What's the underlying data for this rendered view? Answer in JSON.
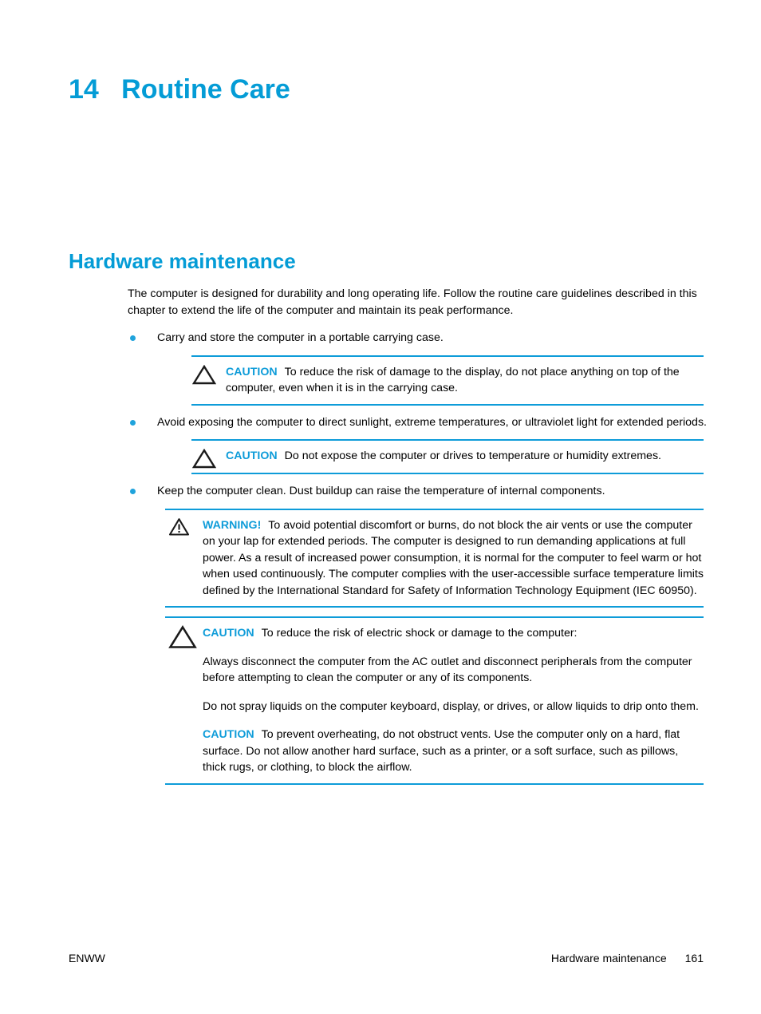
{
  "document": {
    "chapter_number": "14",
    "chapter_title": "Routine Care",
    "section_heading": "Hardware maintenance",
    "accent_color": "#049CD6",
    "rule_color": "#0E9CD9",
    "bullet_color": "#1FA3DC"
  },
  "intro": {
    "paragraph": "The computer is designed for durability and long operating life. Follow the routine care guidelines described in this chapter to extend the life of the computer and maintain its peak performance."
  },
  "bullets": [
    {
      "text": "Carry and store the computer in a portable carrying case."
    },
    {
      "text": "Avoid exposing the computer to direct sunlight, extreme temperatures, or ultraviolet light for extended periods."
    },
    {
      "text": "Keep the computer clean. Dust buildup can raise the temperature of internal components."
    }
  ],
  "admonitions": {
    "caution1": {
      "label": "CAUTION",
      "icon": "caution-triangle-icon",
      "text": "To reduce the risk of damage to the display, do not place anything on top of the computer, even when it is in the carrying case."
    },
    "caution2": {
      "label": "CAUTION",
      "icon": "caution-triangle-icon",
      "text": "Do not expose the computer or drives to temperature or humidity extremes."
    },
    "warning1": {
      "label": "WARNING!",
      "icon": "warning-triangle-exclamation-icon",
      "text": "To avoid potential discomfort or burns, do not block the air vents or use the computer on your lap for extended periods. The computer is designed to run demanding applications at full power. As a result of increased power consumption, it is normal for the computer to feel warm or hot when used continuously. The computer complies with the user-accessible surface temperature limits defined by the International Standard for Safety of Information Technology Equipment (IEC 60950)."
    },
    "caution3": {
      "label": "CAUTION",
      "icon": "caution-triangle-icon",
      "lead_text": "To reduce the risk of electric shock or damage to the computer:",
      "paragraph1": "Always disconnect the computer from the AC outlet and disconnect peripherals from the computer before attempting to clean the computer or any of its components.",
      "paragraph2": "Do not spray liquids on the computer keyboard, display, or drives, or allow liquids to drip onto them.",
      "nested_label": "CAUTION",
      "paragraph3": "To prevent overheating, do not obstruct vents. Use the computer only on a hard, flat surface. Do not allow another hard surface, such as a printer, or a soft surface, such as pillows, thick rugs, or clothing, to block the airflow."
    }
  },
  "footer": {
    "left": "ENWW",
    "section": "Hardware maintenance",
    "page_number": "161"
  }
}
